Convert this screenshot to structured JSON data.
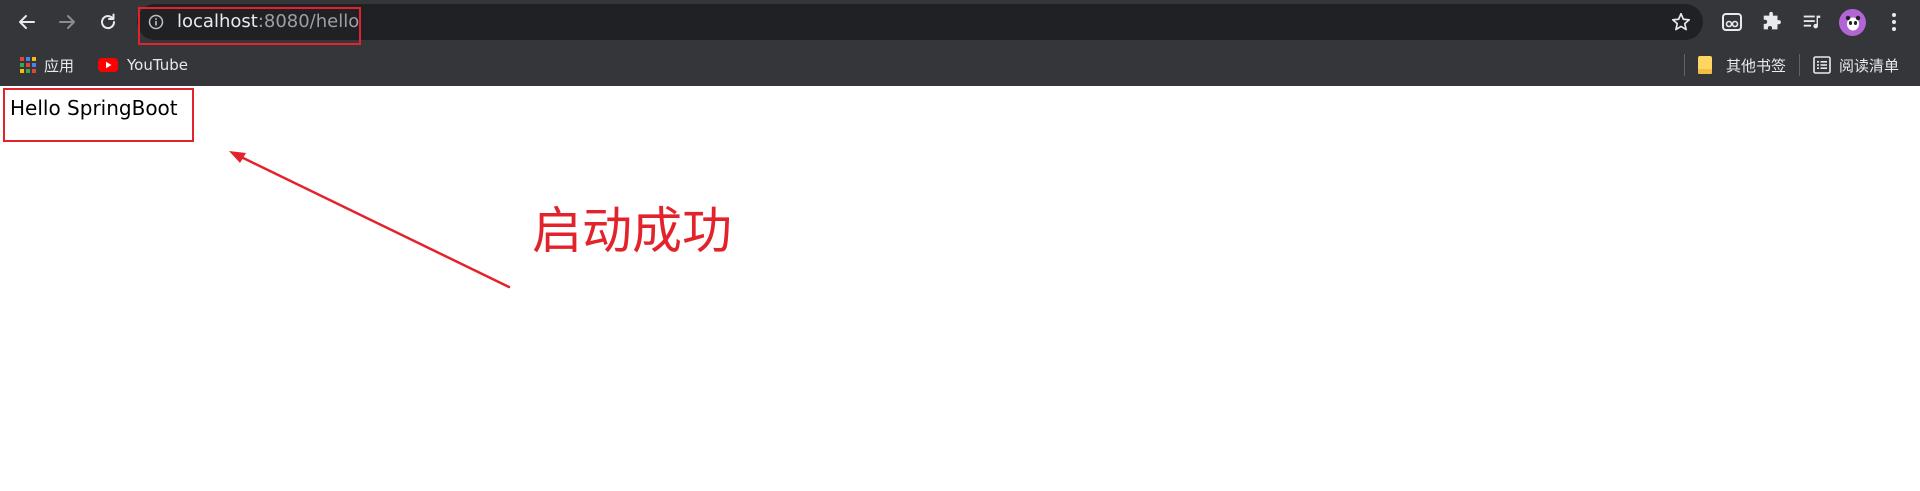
{
  "browser": {
    "url": {
      "host": "localhost",
      "rest": ":8080/hello"
    },
    "bookmarks": {
      "apps_label": "应用",
      "youtube_label": "YouTube",
      "other_bookmarks_label": "其他书签",
      "reading_list_label": "阅读清单"
    }
  },
  "page": {
    "body_text": "Hello SpringBoot"
  },
  "annotation": {
    "caption": "启动成功",
    "color": "#e3232b"
  },
  "colors": {
    "toolbar_bg": "#35363a",
    "omnibox_bg": "#202124",
    "youtube_red": "#ff0000",
    "avatar_bg": "#b266d6"
  }
}
